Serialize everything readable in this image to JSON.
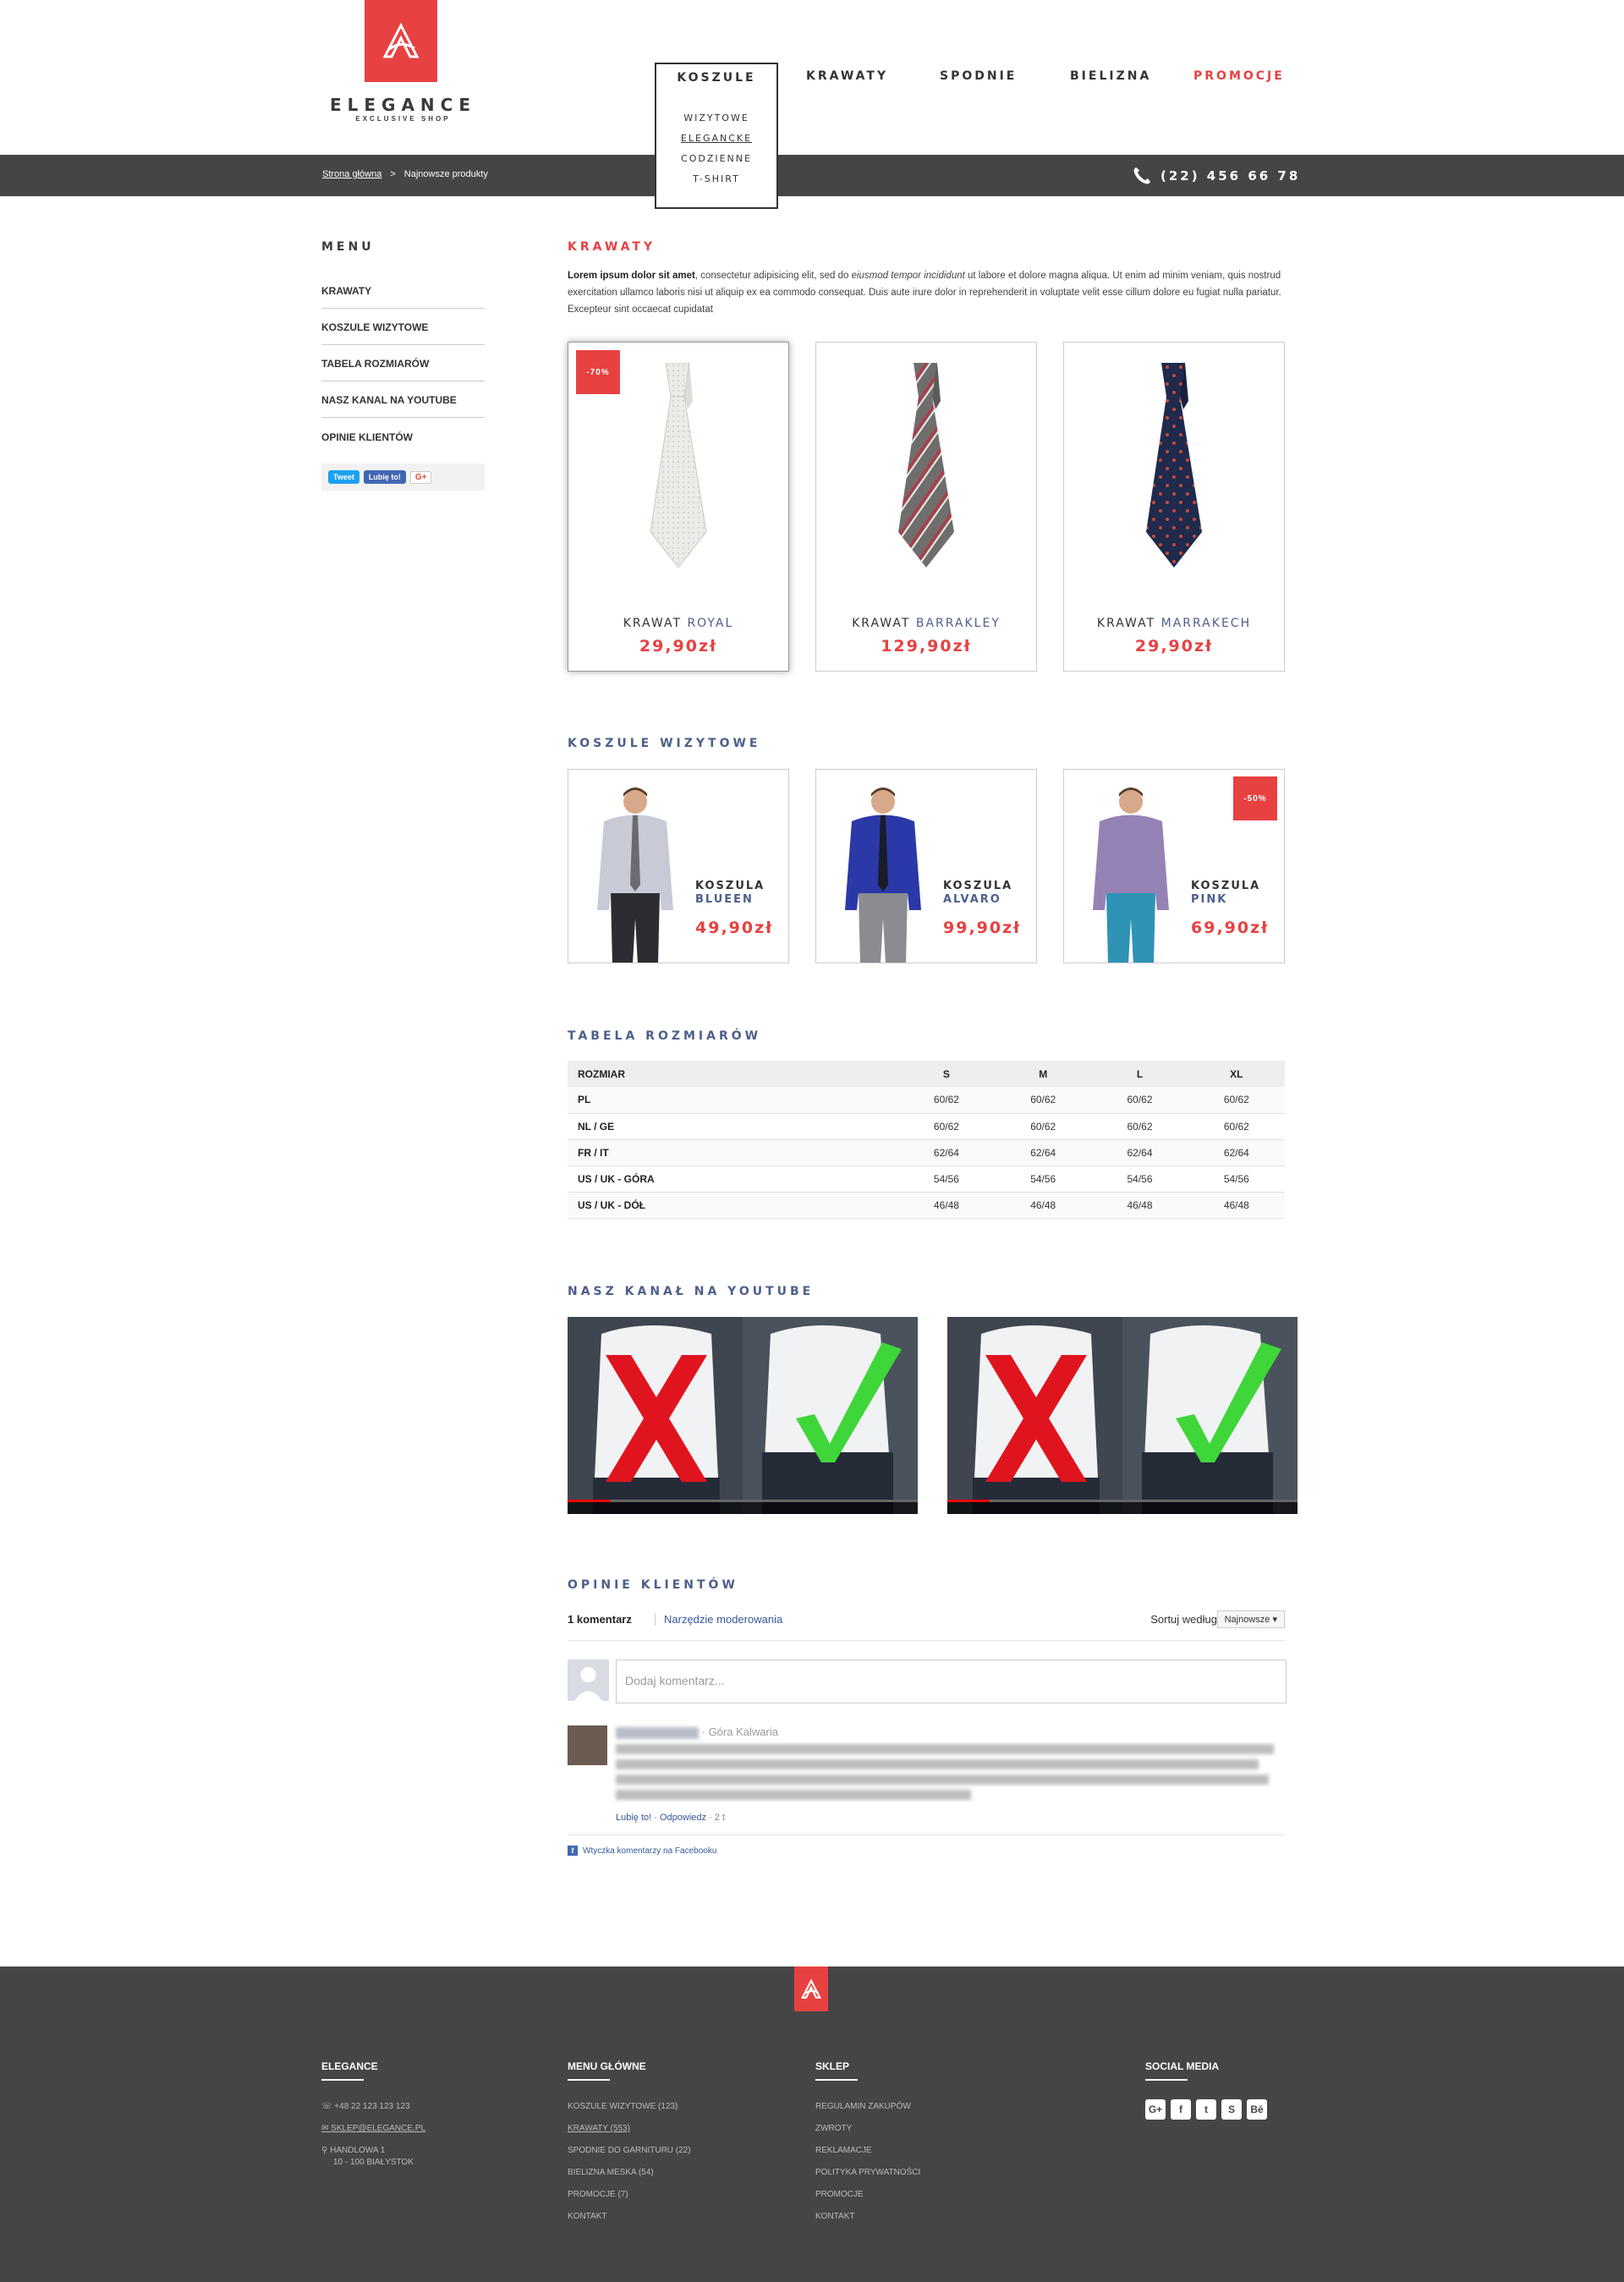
{
  "brand": {
    "name": "ELEGANCE",
    "tagline": "EXCLUSIVE SHOP",
    "accent": "#e84141",
    "dark": "#454545"
  },
  "nav": {
    "items": [
      {
        "label": "KOSZULE"
      },
      {
        "label": "KRAWATY"
      },
      {
        "label": "SPODNIE"
      },
      {
        "label": "BIELIZNA"
      },
      {
        "label": "PROMOCJE"
      }
    ],
    "dropdown": [
      "WIZYTOWE",
      "ELEGANCKE",
      "CODZIENNE",
      "T-SHIRT"
    ]
  },
  "breadcrumb": {
    "home": "Strona główna",
    "sep": ">",
    "current": "Najnowsze produkty"
  },
  "phone": "(22) 456 66 78",
  "sidebar": {
    "title": "MENU",
    "items": [
      {
        "label": "KRAWATY"
      },
      {
        "label": "KOSZULE WIZYTOWE"
      },
      {
        "label": "TABELA ROZMIARÓW"
      },
      {
        "label": "NASZ KANAL NA YOUTUBE"
      },
      {
        "label": "OPINIE KLIENTÓW"
      }
    ],
    "social": {
      "tweet": "Tweet",
      "like": "Lubię to!",
      "gplus": "G+"
    }
  },
  "ties": {
    "title": "KRAWATY",
    "intro_bold": "Lorem ipsum dolor sit amet",
    "intro_a": ", consectetur adipisicing elit, sed do ",
    "intro_em": "eiusmod tempor incididunt",
    "intro_b": " ut labore et dolore magna aliqua. Ut enim ad minim veniam, quis nostrud exercitation ullamco laboris nisi ut aliquip ex ea commodo consequat. Duis aute irure dolor in reprehenderit in voluptate velit esse cillum dolore eu fugiat nulla pariatur. Excepteur sint occaecat cupidatat",
    "products": [
      {
        "type": "KRAWAT",
        "name": "ROYAL",
        "price": "29,90zł",
        "badge": "-70%",
        "icon": "tie-icon"
      },
      {
        "type": "KRAWAT",
        "name": "BARRAKLEY",
        "price": "129,90zł",
        "badge": "",
        "icon": "tie-icon"
      },
      {
        "type": "KRAWAT",
        "name": "MARRAKECH",
        "price": "29,90zł",
        "badge": "",
        "icon": "tie-icon"
      }
    ]
  },
  "shirts": {
    "title": "KOSZULE WIZYTOWE",
    "products": [
      {
        "type": "KOSZULA",
        "name": "BLUEEN",
        "price": "49,90zł",
        "badge": ""
      },
      {
        "type": "KOSZULA",
        "name": "ALVARO",
        "price": "99,90zł",
        "badge": ""
      },
      {
        "type": "KOSZULA",
        "name": "PINK",
        "price": "69,90zł",
        "badge": "-50%"
      }
    ]
  },
  "sizes": {
    "title": "TABELA ROZMIARÓW",
    "headers": [
      "ROZMIAR",
      "S",
      "M",
      "L",
      "XL"
    ],
    "rows": [
      [
        "PL",
        "60/62",
        "60/62",
        "60/62",
        "60/62"
      ],
      [
        "NL / GE",
        "60/62",
        "60/62",
        "60/62",
        "60/62"
      ],
      [
        "FR / IT",
        "62/64",
        "62/64",
        "62/64",
        "62/64"
      ],
      [
        "US / UK - GÓRA",
        "54/56",
        "54/56",
        "54/56",
        "54/56"
      ],
      [
        "US / UK - DÓŁ",
        "46/48",
        "46/48",
        "46/48",
        "46/48"
      ]
    ]
  },
  "youtube": {
    "title": "NASZ KANAŁ NA YOUTUBE",
    "progress": 0.12
  },
  "comments": {
    "title": "OPINIE KLIENTÓW",
    "count": "1 komentarz",
    "moderation": "Narzędzie moderowania",
    "sort_label": "Sortuj według",
    "sort_value": "Najnowsze ▾",
    "placeholder": "Dodaj komentarz...",
    "user_location": "· Góra Kalwaria",
    "actions": "Lubię to! · Odpowiedz",
    "time": "· 2 t",
    "plugin": "Wtyczka komentarzy na Facebooku"
  },
  "footer": {
    "cols": [
      {
        "title": "ELEGANCE",
        "items": [
          "+48 22 123 123 123",
          "SKLEP@ELEGANCE.PL",
          "HANDLOWA 1",
          "10 - 100 BIAŁYSTOK"
        ]
      },
      {
        "title": "MENU GŁÓWNE",
        "items": [
          "KOSZULE  WIZYTOWE (123)",
          "KRAWATY (553)",
          "SPODNIE DO GARNITURU (22)",
          "BIELIZNA MESKA (54)",
          "PROMOCJE (7)",
          "KONTAKT"
        ]
      },
      {
        "title": "SKLEP",
        "items": [
          "REGULAMIN ZAKUPÓW",
          "ZWROTY",
          "REKLAMACJE",
          "POLITYKA PRYWATNOŚCI",
          "PROMOCJE",
          "KONTAKT"
        ]
      },
      {
        "title": "SOCIAL MEDIA",
        "icons": [
          "G+",
          "f",
          "t",
          "S",
          "Bē"
        ]
      }
    ]
  }
}
